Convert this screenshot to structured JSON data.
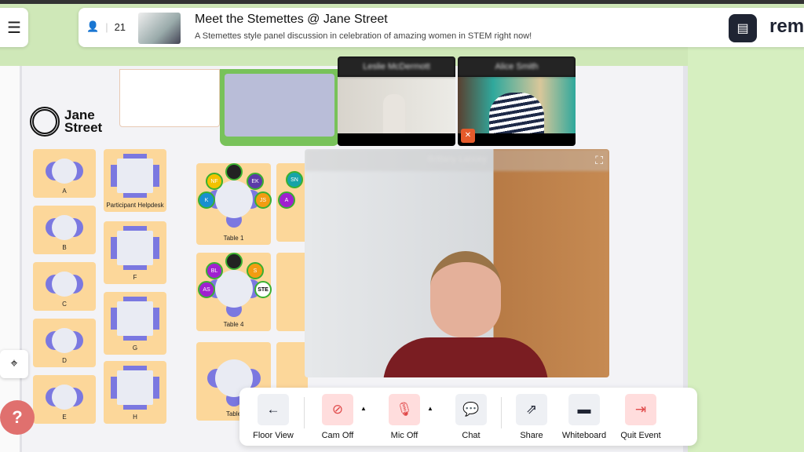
{
  "header": {
    "attendee_count": "21",
    "title": "Meet the Stemettes @ Jane Street",
    "subtitle": "A Stemettes style panel discussion in celebration of amazing women in STEM right now!",
    "brand": "rem"
  },
  "floor": {
    "logo_text_1": "Jane",
    "logo_text_2": "Street",
    "tables": [
      {
        "label": "A",
        "shape": "round"
      },
      {
        "label": "B",
        "shape": "round"
      },
      {
        "label": "C",
        "shape": "round"
      },
      {
        "label": "D",
        "shape": "round"
      },
      {
        "label": "E",
        "shape": "round"
      },
      {
        "label": "Participant Helpdesk",
        "shape": "rect"
      },
      {
        "label": "F",
        "shape": "rect"
      },
      {
        "label": "G",
        "shape": "rect"
      },
      {
        "label": "H",
        "shape": "rect"
      },
      {
        "label": "Table 1",
        "shape": "big"
      },
      {
        "label": "Table 4",
        "shape": "big"
      },
      {
        "label": "Table",
        "shape": "big"
      }
    ],
    "avatars": [
      {
        "initials": "NF",
        "color": "#f2c200",
        "table": "Table 1"
      },
      {
        "initials": "",
        "color": "#222",
        "table": "Table 1"
      },
      {
        "initials": "EK",
        "color": "#5b3aa8",
        "table": "Table 1"
      },
      {
        "initials": "K",
        "color": "#1a8fd0",
        "table": "Table 1"
      },
      {
        "initials": "JS",
        "color": "#f39c12",
        "table": "Table 1"
      },
      {
        "initials": "SN",
        "color": "#16a3a8",
        "table": ""
      },
      {
        "initials": "A",
        "color": "#a020d0",
        "table": ""
      },
      {
        "initials": "BL",
        "color": "#a020d0",
        "table": "Table 4"
      },
      {
        "initials": "",
        "color": "#222",
        "table": "Table 4"
      },
      {
        "initials": "S",
        "color": "#f39c12",
        "table": "Table 4"
      },
      {
        "initials": "AS",
        "color": "#a020d0",
        "table": "Table 4"
      },
      {
        "initials": "STE",
        "color": "#fff",
        "table": "Table 4"
      }
    ]
  },
  "videos": {
    "small": [
      {
        "name": "Leslie McDermott",
        "muted": false
      },
      {
        "name": "Alice Smith",
        "muted": true
      }
    ],
    "main": {
      "name": "Brittany Lancey"
    }
  },
  "toolbar": {
    "floor_view": "Floor View",
    "cam_off": "Cam Off",
    "mic_off": "Mic Off",
    "chat": "Chat",
    "share": "Share",
    "whiteboard": "Whiteboard",
    "quit_event": "Quit Event"
  },
  "colors": {
    "accent_dark": "#1f2433",
    "danger": "#e04848",
    "table_fill": "#fcd79a",
    "chair": "#7b78e0"
  }
}
